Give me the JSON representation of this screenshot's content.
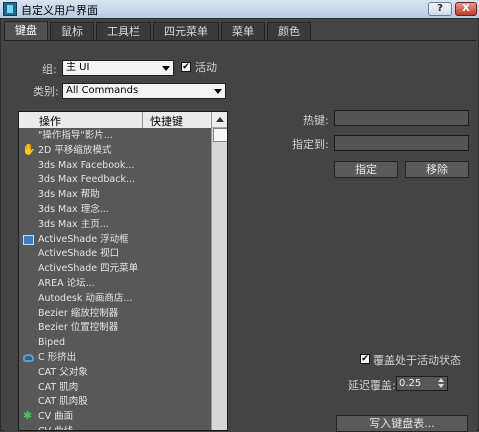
{
  "window": {
    "title": "自定义用户界面",
    "help_label": "?",
    "close_label": "X"
  },
  "tabs": [
    "键盘",
    "鼠标",
    "工具栏",
    "四元菜单",
    "菜单",
    "颜色"
  ],
  "group": {
    "label": "组:",
    "value": "主 UI",
    "active_label": "活动",
    "active_checked": true
  },
  "category": {
    "label": "类别:",
    "value": "All Commands"
  },
  "list": {
    "headers": [
      "操作",
      "快捷键"
    ],
    "rows": [
      {
        "label": "\"操作指导\"影片...",
        "icon": ""
      },
      {
        "label": "2D 平移缩放模式",
        "icon": "hand-icon"
      },
      {
        "label": "3ds Max Facebook...",
        "icon": ""
      },
      {
        "label": "3ds Max Feedback...",
        "icon": ""
      },
      {
        "label": "3ds Max 帮助",
        "icon": ""
      },
      {
        "label": "3ds Max 理念...",
        "icon": ""
      },
      {
        "label": "3ds Max 主页...",
        "icon": ""
      },
      {
        "label": "ActiveShade 浮动框",
        "icon": "activeshade-icon"
      },
      {
        "label": "ActiveShade 视口",
        "icon": ""
      },
      {
        "label": "ActiveShade 四元菜单",
        "icon": ""
      },
      {
        "label": "AREA 论坛...",
        "icon": ""
      },
      {
        "label": "Autodesk 动画商店...",
        "icon": ""
      },
      {
        "label": "Bezier 缩放控制器",
        "icon": ""
      },
      {
        "label": "Bezier 位置控制器",
        "icon": ""
      },
      {
        "label": "Biped",
        "icon": ""
      },
      {
        "label": "C 形挤出",
        "icon": "c-shape-icon"
      },
      {
        "label": "CAT 父对象",
        "icon": ""
      },
      {
        "label": "CAT 肌肉",
        "icon": ""
      },
      {
        "label": "CAT 肌肉股",
        "icon": ""
      },
      {
        "label": "CV 曲面",
        "icon": "cv-surface-icon"
      },
      {
        "label": "CV 曲线",
        "icon": ""
      }
    ]
  },
  "hotkey": {
    "label": "热键:",
    "value": ""
  },
  "assigned_to": {
    "label": "指定到:",
    "value": ""
  },
  "buttons": {
    "assign": "指定",
    "remove": "移除",
    "write_keyboard": "写入键盘表..."
  },
  "override": {
    "label": "覆盖处于活动状态",
    "checked": true
  },
  "delay": {
    "label": "延迟覆盖:",
    "value": "0.25"
  }
}
